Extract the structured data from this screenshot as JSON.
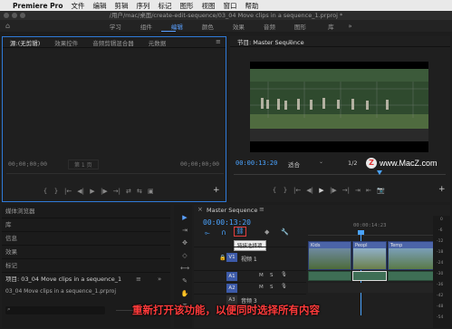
{
  "menubar": {
    "app_name": "Premiere Pro",
    "items": [
      "文件",
      "编辑",
      "剪辑",
      "序列",
      "标记",
      "图形",
      "视图",
      "窗口",
      "帮助"
    ]
  },
  "window_title": "/用户/mac/桌面/create-edit-sequence/03_04 Move clips in a sequence_1.prproj *",
  "workspaces": {
    "tabs": [
      "学习",
      "组件",
      "编辑",
      "颜色",
      "效果",
      "音频",
      "图形",
      "库"
    ],
    "active": "编辑",
    "more": "»"
  },
  "source_panel": {
    "tabs": [
      "源:(无剪辑)",
      "效果控件",
      "音频剪辑混合器",
      "元数据"
    ],
    "menu_glyph": "≡",
    "timecode_left": "00;00;00;00",
    "page_label": "第 1 页",
    "timecode_right": "00;00;00;00",
    "controls": [
      "{",
      "}",
      "|←",
      "◀|",
      "▶",
      "|▶",
      "→|",
      "⇄",
      "⇆",
      "▣",
      "+"
    ]
  },
  "program_panel": {
    "tab": "节目: Master Sequence",
    "menu_glyph": "≡",
    "timecode": "00:00:13:20",
    "fit_label": "适合",
    "fraction": "1/2",
    "controls": [
      "{",
      "}",
      "|←",
      "◀|",
      "▶",
      "|▶",
      "→|",
      "⇥",
      "⇤",
      "📷",
      "+"
    ]
  },
  "watermark": "www.MacZ.com",
  "watermark_letter": "Z",
  "timeline": {
    "close_glyph": "×",
    "tab": "Master Sequence",
    "menu_glyph": "≡",
    "timecode": "00:00:13:20",
    "ruler_times": [
      "00:00:14:23"
    ],
    "tooltip": "链接选择项",
    "tracks": [
      {
        "name": "V1",
        "label": "视频 1"
      },
      {
        "name": "A1"
      },
      {
        "name": "A2"
      },
      {
        "name": "A3",
        "label": "音频 3"
      }
    ],
    "audio_track_buttons": [
      "M",
      "S",
      "🎙"
    ],
    "clip_labels": [
      "Kids",
      "Peopl",
      "Temp"
    ],
    "db_levels": [
      "0",
      "-6",
      "-12",
      "-18",
      "-24",
      "-30",
      "-36",
      "-42",
      "-48",
      "-54"
    ]
  },
  "project_panel": {
    "tabs": [
      "媒体浏览器",
      "库",
      "信息",
      "效果",
      "标记"
    ],
    "project_label": "项目: 03_04 Move clips in a sequence_1",
    "project_file": "03_04 Move clips in a sequence_1.prproj",
    "menu_glyph": "≡",
    "more_glyph": "»"
  },
  "caption": "重新打开该功能，以便同时选择所有内容",
  "colors": {
    "accent_blue": "#2f7ad8",
    "timecode_blue": "#4aa3ff",
    "caption_red": "#ff3b3b",
    "clip_blue": "#4b64a8",
    "clip_green": "#3e6e55",
    "highlight_border": "#e23d3d"
  }
}
